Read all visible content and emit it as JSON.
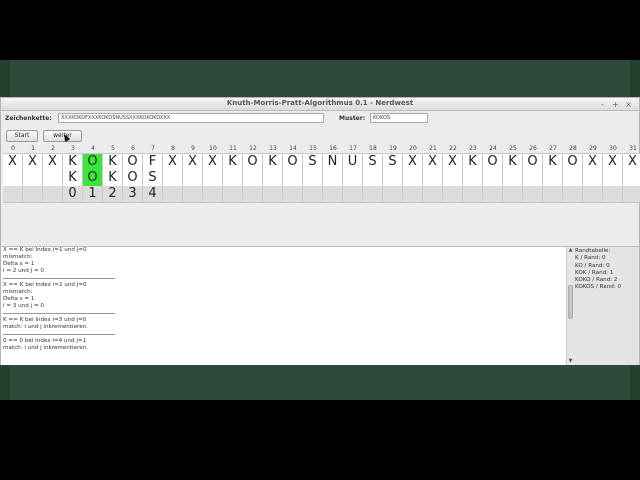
{
  "window": {
    "title": "Knuth-Morris-Pratt-Algorithmus 0.1 - Nerdwest",
    "minimize": "-",
    "maximize": "+",
    "close": "×"
  },
  "inputs": {
    "text_label": "Zeichenkette:",
    "text_value": "XXXKOKOFXXXKOKOSNUSSXXXKOKOKOXXX",
    "pattern_label": "Muster:",
    "pattern_value": "KOKOS"
  },
  "buttons": {
    "start": "Start",
    "next": "weiter"
  },
  "grid": {
    "indices": [
      "0",
      "1",
      "2",
      "3",
      "4",
      "5",
      "6",
      "7",
      "8",
      "9",
      "10",
      "11",
      "12",
      "13",
      "14",
      "15",
      "16",
      "17",
      "18",
      "19",
      "20",
      "21",
      "22",
      "23",
      "24",
      "25",
      "26",
      "27",
      "28",
      "29",
      "30",
      "31"
    ],
    "text": [
      "X",
      "X",
      "X",
      "K",
      "O",
      "K",
      "O",
      "F",
      "X",
      "X",
      "X",
      "K",
      "O",
      "K",
      "O",
      "S",
      "N",
      "U",
      "S",
      "S",
      "X",
      "X",
      "X",
      "K",
      "O",
      "K",
      "O",
      "K",
      "O",
      "X",
      "X",
      "X"
    ],
    "pattern": [
      "",
      "",
      "",
      "K",
      "O",
      "K",
      "O",
      "S",
      "",
      "",
      "",
      "",
      "",
      "",
      "",
      "",
      "",
      "",
      "",
      "",
      "",
      "",
      "",
      "",
      "",
      "",
      "",
      "",
      "",
      "",
      "",
      ""
    ],
    "border": [
      "",
      "",
      "",
      "0",
      "1",
      "2",
      "3",
      "4",
      "",
      "",
      "",
      "",
      "",
      "",
      "",
      "",
      "",
      "",
      "",
      "",
      "",
      "",
      "",
      "",
      "",
      "",
      "",
      "",
      "",
      "",
      "",
      ""
    ],
    "highlight_index": 4,
    "highlight_color": "#39e639"
  },
  "log": {
    "groups": [
      [
        "X == K bei Index i=1 und j=0",
        "mismatch:",
        "Delta s = 1",
        "i = 2 und j = 0"
      ],
      [
        "X == K bei Index i=2 und j=0",
        "mismatch:",
        "Delta s = 1",
        "i = 3 und j = 0"
      ],
      [
        "K == K bei Index i=3 und j=0",
        "match: i und j inkrementieren."
      ],
      [
        "0 == 0 bei Index i=4 und j=1",
        "match: i und j inkrementieren."
      ]
    ]
  },
  "border_table": {
    "lines": [
      "Randtabelle:",
      "K / Rand: 0",
      "KO / Rand: 0",
      "KOK / Rand: 1",
      "KOKO / Rand: 2",
      "KOKOS / Rand: 0"
    ]
  }
}
